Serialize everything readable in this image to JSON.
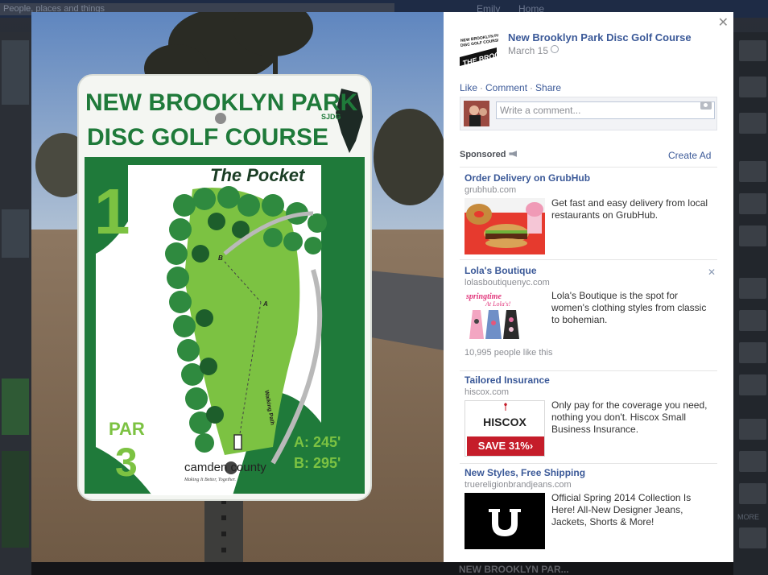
{
  "background": {
    "search_text": "People, places and things",
    "user_name": "Emily",
    "home_label": "Home",
    "more_label": "MORE",
    "photo_caption": "NEW BROOKLYN PAR..."
  },
  "photo": {
    "sign_title_1": "NEW BROOKLYN PARK",
    "sign_title_2": "DISC GOLF COURSE",
    "sign_org": "SJDG",
    "hole_number": "1",
    "hole_name": "The Pocket",
    "par_label": "PAR",
    "par_value": "3",
    "tee_a": "A: 245'",
    "tee_b": "B: 295'",
    "sponsor": "camden county",
    "sponsor_tagline": "Making It Better, Together.",
    "map_label_a": "A",
    "map_label_b": "B",
    "map_path_label": "Walking Path"
  },
  "post": {
    "page_name": "New Brooklyn Park Disc Golf Course",
    "date": "March 15",
    "logo_text_1": "NEW BROOKLYN PARK",
    "logo_text_2": "DISC GOLF COURSE",
    "logo_text_3": "THE BROOK",
    "actions": {
      "like": "Like",
      "comment": "Comment",
      "share": "Share"
    },
    "comment_placeholder": "Write a comment..."
  },
  "ads_header": {
    "sponsored": "Sponsored",
    "create_ad": "Create Ad"
  },
  "ads": [
    {
      "title": "Order Delivery on GrubHub",
      "domain": "grubhub.com",
      "text": "Get fast and easy delivery from local restaurants on GrubHub."
    },
    {
      "title": "Lola's Boutique",
      "domain": "lolasboutiquenyc.com",
      "text": "Lola's Boutique is the spot for women's clothing styles from classic to bohemian.",
      "likes": "10,995 people like this",
      "image_text_1": "springtime",
      "image_text_2": "At Lola's!"
    },
    {
      "title": "Tailored Insurance",
      "domain": "hiscox.com",
      "text": "Only pay for the coverage you need, nothing you don't. Hiscox Small Business Insurance.",
      "image_brand": "HISCOX",
      "image_offer": "SAVE 31%›"
    },
    {
      "title": "New Styles, Free Shipping",
      "domain": "truereligionbrandjeans.com",
      "text": "Official Spring 2014 Collection Is Here! All-New Designer Jeans, Jackets, Shorts & More!"
    }
  ],
  "colors": {
    "link": "#3b5998",
    "sign_green": "#1f7a3a",
    "hiscox_red": "#c51d2a"
  }
}
